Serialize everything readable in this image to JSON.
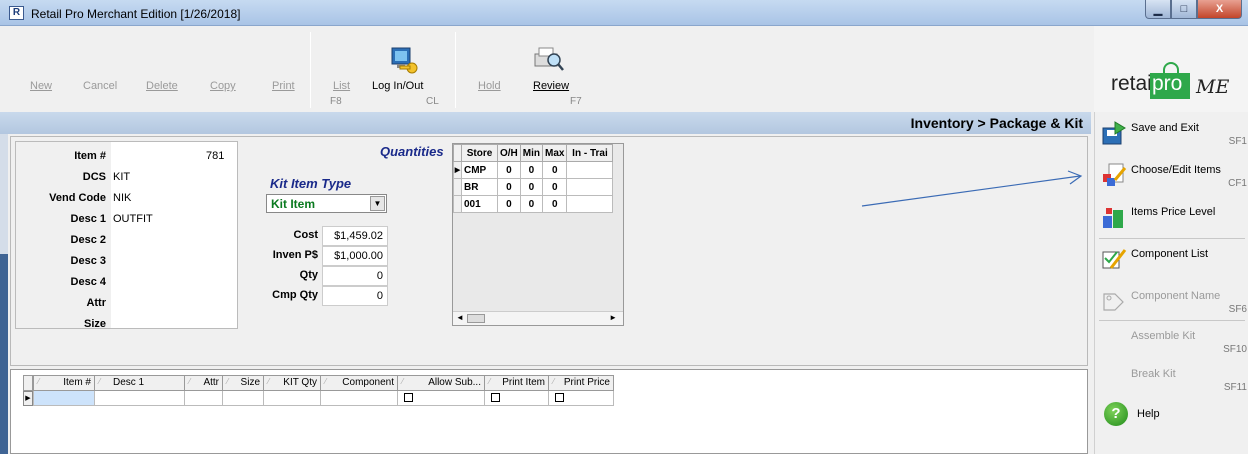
{
  "window": {
    "title": "Retail Pro Merchant Edition [1/26/2018]",
    "min_glyph": "▁",
    "max_glyph": "□",
    "close_glyph": "X"
  },
  "toolbar": {
    "new": "New",
    "cancel": "Cancel",
    "delete": "Delete",
    "copy": "Copy",
    "print": "Print",
    "list": "List",
    "list_key": "F8",
    "login": "Log In/Out",
    "login_key": "CL",
    "hold": "Hold",
    "review": "Review",
    "review_key": "F7"
  },
  "logo": {
    "word": "retail",
    "pro": "pro",
    "me": "ME"
  },
  "breadcrumb": "Inventory > Package & Kit",
  "item": {
    "labels": [
      "Item #",
      "DCS",
      "Vend Code",
      "Desc 1",
      "Desc 2",
      "Desc 3",
      "Desc 4",
      "Attr",
      "Size"
    ],
    "item_no": "781",
    "dcs": "KIT",
    "vend_code": "NIK",
    "desc1": "OUTFIT"
  },
  "kit": {
    "title": "Kit Item Type",
    "selected": "Kit Item",
    "dropdown_glyph": "▼"
  },
  "costs": {
    "cost_label": "Cost",
    "cost_value": "$1,459.02",
    "inven_label": "Inven P$",
    "inven_value": "$1,000.00",
    "qty_label": "Qty",
    "qty_value": "0",
    "cmp_label": "Cmp Qty",
    "cmp_value": "0"
  },
  "quantities": {
    "title": "Quantities",
    "headers": [
      "Store",
      "O/H",
      "Min",
      "Max",
      "In - Trai"
    ],
    "rows": [
      {
        "store": "CMP",
        "oh": "0",
        "min": "0",
        "max": "0"
      },
      {
        "store": "BR",
        "oh": "0",
        "min": "0",
        "max": "0"
      },
      {
        "store": "001",
        "oh": "0",
        "min": "0",
        "max": "0"
      }
    ],
    "scroll_left_glyph": "◄",
    "scroll_right_glyph": "►"
  },
  "detail": {
    "columns": [
      "Item #",
      "Desc 1",
      "Attr",
      "Size",
      "KIT Qty",
      "Component",
      "Allow Sub...",
      "Print Item",
      "Print Price"
    ],
    "row_indicator": "▶"
  },
  "sidebar": {
    "save_exit": "Save and Exit",
    "save_key": "SF1",
    "choose_edit": "Choose/Edit Items",
    "choose_key": "CF1",
    "price_level": "Items Price Level",
    "component_list": "Component List",
    "component_name": "Component Name",
    "component_name_key": "SF6",
    "assemble": "Assemble Kit",
    "assemble_key": "SF10",
    "break": "Break Kit",
    "break_key": "SF11",
    "help": "Help",
    "help_glyph": "?"
  },
  "colors": {
    "band": "#b3c7e0",
    "accent_green": "#2ea84a",
    "kit_green": "#0a7a1f",
    "title_blue": "#1a2a8a",
    "arrow_blue": "#3b6bb5"
  }
}
